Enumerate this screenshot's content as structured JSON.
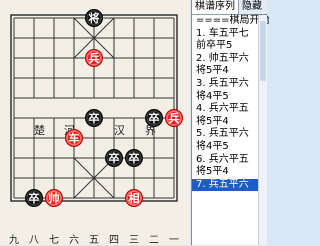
{
  "board": {
    "column_labels": [
      "九",
      "八",
      "七",
      "六",
      "五",
      "四",
      "三",
      "二",
      "一"
    ],
    "river_labels": [
      "楚",
      "河",
      "汉",
      "界"
    ],
    "pieces": [
      {
        "name": "black-general",
        "label": "将",
        "side": "black",
        "col": 4,
        "row": 0
      },
      {
        "name": "red-soldier-center",
        "label": "兵",
        "side": "red",
        "col": 4,
        "row": 2
      },
      {
        "name": "red-soldier-right",
        "label": "兵",
        "side": "red",
        "col": 8,
        "row": 5
      },
      {
        "name": "black-soldier-1",
        "label": "卒",
        "side": "black",
        "col": 4,
        "row": 5
      },
      {
        "name": "black-soldier-2",
        "label": "卒",
        "side": "black",
        "col": 7,
        "row": 5
      },
      {
        "name": "red-chariot",
        "label": "车",
        "side": "red",
        "col": 3,
        "row": 6
      },
      {
        "name": "black-soldier-3",
        "label": "卒",
        "side": "black",
        "col": 5,
        "row": 7
      },
      {
        "name": "black-soldier-4",
        "label": "卒",
        "side": "black",
        "col": 6,
        "row": 7
      },
      {
        "name": "black-soldier-5",
        "label": "卒",
        "side": "black",
        "col": 1,
        "row": 9
      },
      {
        "name": "red-marshal",
        "label": "帅",
        "side": "red",
        "col": 2,
        "row": 9
      },
      {
        "name": "red-minister",
        "label": "相",
        "side": "red",
        "col": 6,
        "row": 9
      }
    ]
  },
  "panel": {
    "tabs": [
      "棋谱序列",
      "隐藏"
    ],
    "moves": [
      "====棋局开始",
      "1. 车五平七",
      "   前卒平5",
      "2. 帅五平六",
      "   将5平4",
      "3. 兵五平六",
      "   将4平5",
      "4. 兵六平五",
      "   将5平4",
      "5. 兵五平六",
      "   将4平5",
      "6. 兵六平五",
      "   将5平4",
      "7. 兵五平六"
    ],
    "selected_index": 13
  },
  "colors": {
    "red_piece": "#e02020",
    "black_piece": "#111111",
    "selection": "#1e5cc8"
  }
}
